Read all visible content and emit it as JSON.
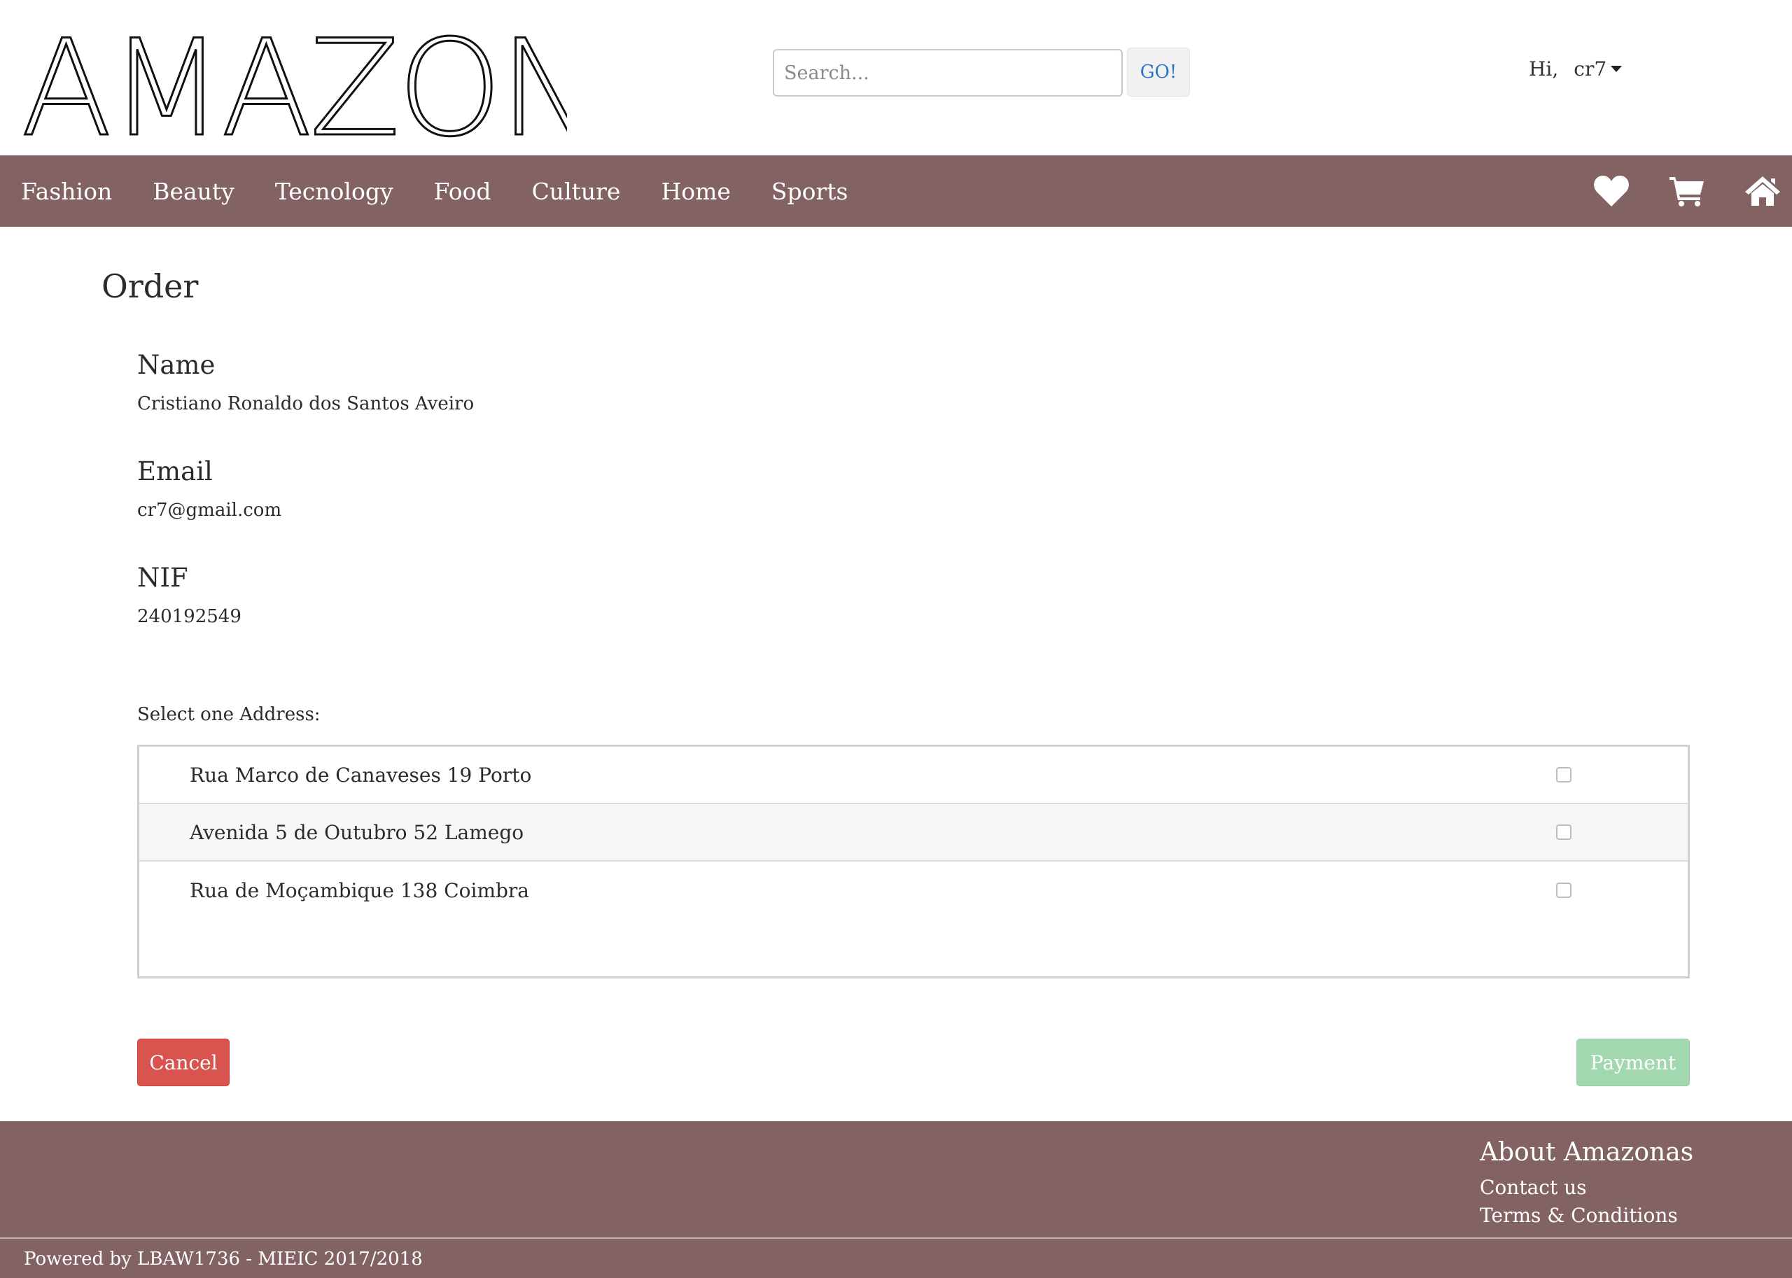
{
  "header": {
    "logo_text": "AMAZONAS",
    "search": {
      "placeholder": "Search...",
      "value": ""
    },
    "go_label": "GO!",
    "greeting": "Hi,",
    "username": "cr7"
  },
  "nav": {
    "links": [
      "Fashion",
      "Beauty",
      "Tecnology",
      "Food",
      "Culture",
      "Home",
      "Sports"
    ],
    "icons": [
      "heart-icon",
      "cart-icon",
      "home-icon"
    ]
  },
  "main": {
    "title": "Order",
    "fields": [
      {
        "label": "Name",
        "value": "Cristiano Ronaldo dos Santos Aveiro"
      },
      {
        "label": "Email",
        "value": "cr7@gmail.com"
      },
      {
        "label": "NIF",
        "value": "240192549"
      }
    ],
    "address_prompt": "Select one Address:",
    "addresses": [
      {
        "text": "Rua Marco de Canaveses 19 Porto",
        "checked": false
      },
      {
        "text": "Avenida 5 de Outubro 52 Lamego",
        "checked": false
      },
      {
        "text": "Rua de Moçambique 138 Coimbra",
        "checked": false
      }
    ],
    "cancel_label": "Cancel",
    "payment_label": "Payment"
  },
  "footer": {
    "title": "About Amazonas",
    "links": [
      "Contact us",
      "Terms & Conditions"
    ],
    "powered": "Powered by LBAW1736 - MIEIC 2017/2018"
  },
  "colors": {
    "brand": "#836264",
    "cancel": "#d9534f",
    "payment_disabled": "#a3d7b0",
    "link": "#2a73c6"
  }
}
